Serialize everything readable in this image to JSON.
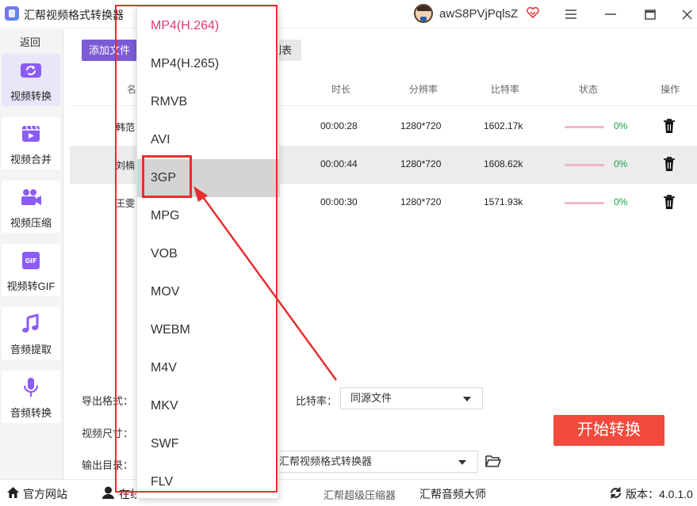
{
  "app": {
    "title": "汇帮视频格式转换器",
    "username": "awS8PVjPqlsZ"
  },
  "sidebar": {
    "back_label": "返回",
    "items": [
      {
        "label": "视频转换"
      },
      {
        "label": "视频合并"
      },
      {
        "label": "视频压缩"
      },
      {
        "label": "视频转GIF"
      },
      {
        "label": "音频提取"
      },
      {
        "label": "音频转换"
      }
    ]
  },
  "toolbar": {
    "add_label": "添加文件",
    "clear_label": "列表"
  },
  "table": {
    "headers": {
      "name": "名",
      "duration": "时长",
      "resolution": "分辨率",
      "bitrate": "比特率",
      "status": "状态",
      "action": "操作"
    },
    "rows": [
      {
        "name": "韩范",
        "duration": "00:00:28",
        "resolution": "1280*720",
        "bitrate": "1602.17k",
        "progress": "0%"
      },
      {
        "name": "刘楠",
        "duration": "00:00:44",
        "resolution": "1280*720",
        "bitrate": "1608.62k",
        "progress": "0%"
      },
      {
        "name": "王雯",
        "duration": "00:00:30",
        "resolution": "1280*720",
        "bitrate": "1571.93k",
        "progress": "0%"
      }
    ]
  },
  "settings": {
    "export_format_label": "导出格式：",
    "video_size_label": "视频尺寸：",
    "output_dir_label": "输出目录：",
    "bitrate_label": "比特率：",
    "bitrate_value": "同源文件",
    "output_dir_value": "汇帮视频格式转换器",
    "start_label": "开始转换"
  },
  "dropdown": {
    "options": [
      "MP4(H.264)",
      "MP4(H.265)",
      "RMVB",
      "AVI",
      "3GP",
      "MPG",
      "VOB",
      "MOV",
      "WEBM",
      "M4V",
      "MKV",
      "SWF",
      "FLV"
    ],
    "highlighted": "3GP"
  },
  "footer": {
    "website": "官方网站",
    "service": "在线客服",
    "compressor": "汇帮超级压缩器",
    "audio": "汇帮音频大师",
    "version": "版本：4.0.1.0"
  },
  "colors": {
    "accent": "#7c5cd6",
    "start": "#f24a3c",
    "annotation": "#e62e2e",
    "first_option": "#e23b6b"
  }
}
